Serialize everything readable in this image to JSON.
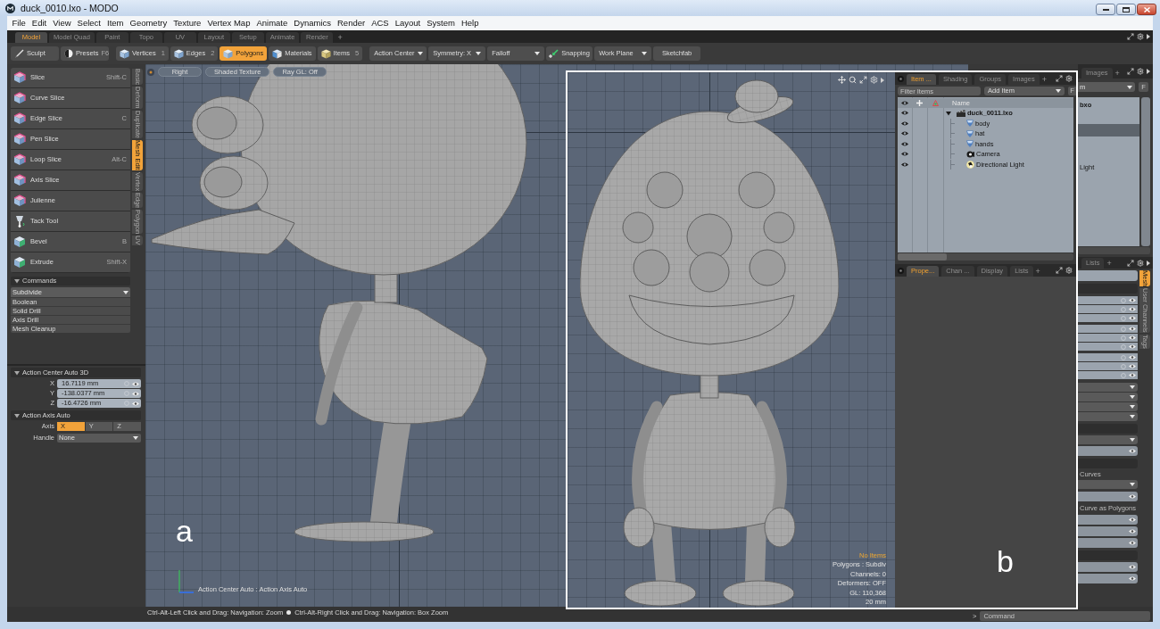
{
  "window": {
    "title": "duck_0010.lxo - MODO"
  },
  "menu": [
    "File",
    "Edit",
    "View",
    "Select",
    "Item",
    "Geometry",
    "Texture",
    "Vertex Map",
    "Animate",
    "Dynamics",
    "Render",
    "ACS",
    "Layout",
    "System",
    "Help"
  ],
  "layout_tabs": {
    "tabs": [
      {
        "label": "Model",
        "selected": true
      },
      {
        "label": "Model Quad",
        "selected": false
      },
      {
        "label": "Paint",
        "selected": false
      },
      {
        "label": "Topo",
        "selected": false
      },
      {
        "label": "UV",
        "selected": false
      },
      {
        "label": "Layout",
        "selected": false
      },
      {
        "label": "Setup",
        "selected": false
      },
      {
        "label": "Animate",
        "selected": false
      },
      {
        "label": "Render",
        "selected": false
      }
    ],
    "add": "+"
  },
  "toolbar": {
    "tools": [
      {
        "kind": "sculpt",
        "label": "Sculpt"
      },
      {
        "kind": "presets",
        "label": "Presets",
        "shortcut": "F6"
      }
    ],
    "modes": [
      {
        "kind": "component",
        "label": "Vertices",
        "shortcut": "1",
        "selected": false
      },
      {
        "kind": "component",
        "label": "Edges",
        "shortcut": "2",
        "selected": false
      },
      {
        "kind": "component",
        "label": "Polygons",
        "selected": true
      },
      {
        "kind": "material",
        "label": "Materials",
        "selected": false
      },
      {
        "kind": "item",
        "label": "Items",
        "shortcut": "5",
        "selected": false
      }
    ],
    "actions": [
      {
        "kind": "dropdown",
        "label": "Action Center"
      },
      {
        "kind": "dropdown",
        "label": "Symmetry: X"
      },
      {
        "kind": "dropdown",
        "label": "Falloff"
      },
      {
        "kind": "toggle",
        "label": "Snapping"
      },
      {
        "kind": "dropdown",
        "label": "Work Plane"
      },
      {
        "kind": "button",
        "label": "Sketchfab"
      }
    ]
  },
  "tool_panel": {
    "tools": [
      {
        "kind": "slice",
        "label": "Slice",
        "shortcut": "Shift-C"
      },
      {
        "kind": "slice",
        "label": "Curve Slice"
      },
      {
        "kind": "slice",
        "label": "Edge Slice",
        "shortcut": "C"
      },
      {
        "kind": "slice",
        "label": "Pen Slice"
      },
      {
        "kind": "slice",
        "label": "Loop Slice",
        "shortcut": "Alt-C"
      },
      {
        "kind": "slice",
        "label": "Axis Slice"
      },
      {
        "kind": "slice",
        "label": "Julienne"
      },
      {
        "kind": "tack",
        "label": "Tack Tool"
      },
      {
        "kind": "polygon",
        "label": "Bevel",
        "shortcut": "B"
      },
      {
        "kind": "polygon",
        "label": "Extrude",
        "shortcut": "Shift-X"
      }
    ],
    "category_tabs": [
      {
        "label": "Basic",
        "selected": false
      },
      {
        "label": "Deform",
        "selected": false
      },
      {
        "label": "Duplicate",
        "selected": false
      },
      {
        "label": "Mesh Edit",
        "selected": true
      },
      {
        "label": "Vertex",
        "selected": false
      },
      {
        "label": "Edge",
        "selected": false
      },
      {
        "label": "Polygon",
        "selected": false
      },
      {
        "label": "UV",
        "selected": false
      }
    ],
    "commands": {
      "title": "Commands",
      "expanded": true,
      "selector": "Subdivide",
      "items": [
        "Boolean",
        "Solid Drill",
        "Axis Drill",
        "Mesh Cleanup"
      ]
    }
  },
  "action_center": {
    "title": "Action Center Auto 3D",
    "expanded": true,
    "fields": [
      {
        "label": "X",
        "value": "16.7119 mm"
      },
      {
        "label": "Y",
        "value": "-138.0377 mm"
      },
      {
        "label": "Z",
        "value": "-16.4726 mm"
      }
    ]
  },
  "action_axis": {
    "title": "Action Axis Auto",
    "expanded": true,
    "axis_label": "Axis",
    "axis_options": [
      {
        "label": "X",
        "selected": true
      },
      {
        "label": "Y",
        "selected": false
      },
      {
        "label": "Z",
        "selected": false
      }
    ],
    "handle_label": "Handle",
    "handle_value": "None"
  },
  "viewport": {
    "view_buttons": [
      "Right",
      "Shaded Texture",
      "Ray GL: Off"
    ],
    "annotation": "a",
    "hud": "Action Center Auto : Action Axis Auto"
  },
  "side_panel": {
    "top_tabs": [
      {
        "label": "Images",
        "selected": false
      }
    ],
    "top_add": "+",
    "filter_value": "m",
    "filter_button": "F",
    "list": [
      {
        "kind": "scene",
        "label": "bxo",
        "selected": false
      },
      {
        "kind": "item",
        "selected": false
      },
      {
        "kind": "item",
        "selected": true
      },
      {
        "kind": "item",
        "selected": false
      },
      {
        "kind": "item",
        "selected": false
      },
      {
        "kind": "item",
        "label": "Light",
        "selected": false
      }
    ],
    "bottom_tabs": [
      {
        "label": "Lists",
        "selected": false
      }
    ],
    "bottom_add": "+",
    "property_tabs": [
      {
        "label": "Mesh",
        "selected": true
      },
      {
        "label": "User Channels",
        "selected": false
      },
      {
        "label": "Tags",
        "selected": false
      }
    ],
    "labels": [
      "Curves",
      "Curve as Polygons"
    ]
  },
  "status_bar": {
    "hints": [
      "Ctrl-Alt-Left Click and Drag: Navigation: Zoom",
      "Ctrl-Alt-Right Click and Drag: Navigation: Box Zoom"
    ]
  },
  "command_line": {
    "prompt": ">",
    "placeholder": "Command"
  },
  "inset": {
    "viewport": {
      "annotation": "b",
      "stats": [
        {
          "kind": "warning",
          "text": "No Items"
        },
        {
          "kind": "info",
          "text": "Polygons : Subdiv"
        },
        {
          "kind": "info",
          "text": "Channels: 0"
        },
        {
          "kind": "info",
          "text": "Deformers: OFF"
        },
        {
          "kind": "info",
          "text": "GL: 110,368"
        },
        {
          "kind": "info",
          "text": "20 mm"
        }
      ]
    },
    "item_list": {
      "tabs": [
        {
          "label": "Item ...",
          "selected": true
        },
        {
          "label": "Shading",
          "selected": false
        },
        {
          "label": "Groups",
          "selected": false
        },
        {
          "label": "Images",
          "selected": false
        }
      ],
      "add_tab": "+",
      "filter_placeholder": "Filter Items",
      "add_item": "Add Item",
      "filter_button": "F",
      "column": "Name",
      "tree": [
        {
          "kind": "scene",
          "label": "duck_0011.lxo",
          "expanded": true,
          "children": [
            {
              "kind": "mesh",
              "label": "body"
            },
            {
              "kind": "mesh",
              "label": "hat"
            },
            {
              "kind": "mesh",
              "label": "hands"
            },
            {
              "kind": "camera",
              "label": "Camera"
            },
            {
              "kind": "light",
              "label": "Directional Light"
            }
          ]
        }
      ]
    },
    "properties": {
      "tabs": [
        {
          "label": "Prope...",
          "selected": true
        },
        {
          "label": "Chan ...",
          "selected": false
        },
        {
          "label": "Display",
          "selected": false
        },
        {
          "label": "Lists",
          "selected": false
        }
      ],
      "add_tab": "+"
    }
  }
}
